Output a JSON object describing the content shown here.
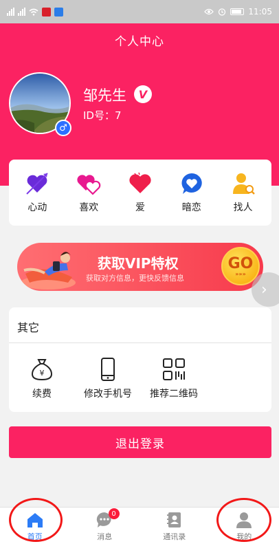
{
  "status_bar": {
    "time": "11:05"
  },
  "header": {
    "title": "个人中心"
  },
  "user": {
    "name": "邹先生",
    "id_text": "ID号：7",
    "vip_mark": "V",
    "gender_symbol": "♂"
  },
  "quick_actions": [
    {
      "label": "心动",
      "icon": "heart-arrow-icon"
    },
    {
      "label": "喜欢",
      "icon": "double-heart-icon"
    },
    {
      "label": "爱",
      "icon": "heart-icon"
    },
    {
      "label": "暗恋",
      "icon": "chat-heart-icon"
    },
    {
      "label": "找人",
      "icon": "find-person-icon"
    }
  ],
  "vip_banner": {
    "title": "获取VIP特权",
    "subtitle": "获取对方信息，更快反馈信息",
    "go_label": "GO",
    "go_arrows": "»»»"
  },
  "side_arrow": "›",
  "other": {
    "title": "其它",
    "items": [
      {
        "label": "续费",
        "icon": "money-bag-icon"
      },
      {
        "label": "修改手机号",
        "icon": "phone-icon"
      },
      {
        "label": "推荐二维码",
        "icon": "qr-code-icon"
      }
    ]
  },
  "logout_label": "退出登录",
  "tabbar": [
    {
      "label": "首页",
      "icon": "home-icon",
      "active": true
    },
    {
      "label": "消息",
      "icon": "message-icon",
      "badge": "0"
    },
    {
      "label": "通讯录",
      "icon": "contacts-icon"
    },
    {
      "label": "我的",
      "icon": "person-icon"
    }
  ],
  "colors": {
    "primary": "#fb2262",
    "tab_active": "#2c7cf6",
    "annotation": "#f21818"
  }
}
